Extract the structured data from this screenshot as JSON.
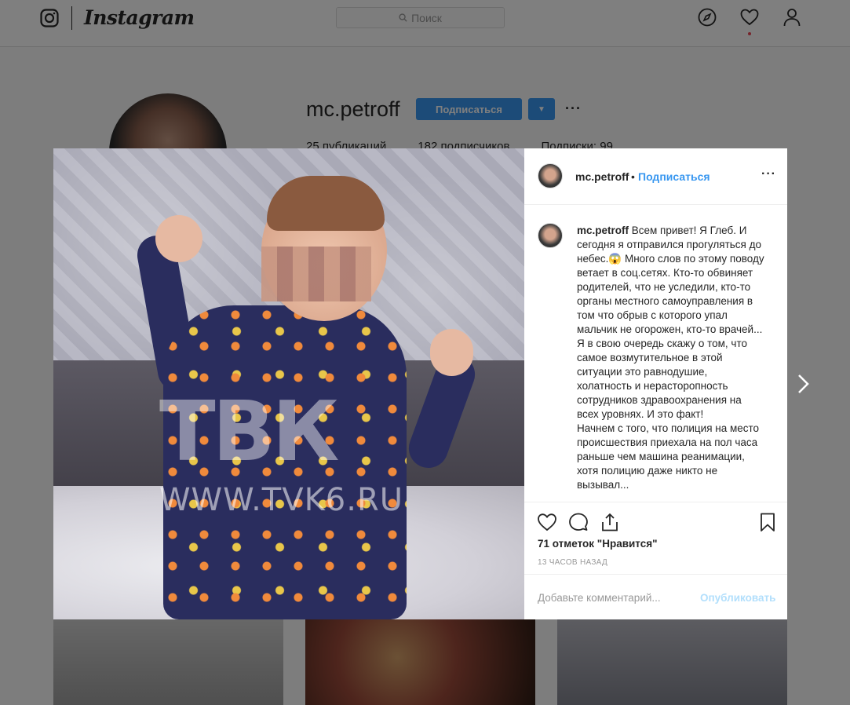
{
  "header": {
    "brand": "Instagram",
    "search_placeholder": "Поиск"
  },
  "profile": {
    "username": "mc.petroff",
    "follow_label": "Подписаться",
    "more_label": "···",
    "stats": [
      "25 публикаций",
      "182 подписчиков",
      "Подписки: 99"
    ]
  },
  "post": {
    "watermark_logo": "ТВК",
    "watermark_site": "WWW.TVK6.RU",
    "header": {
      "username": "mc.petroff",
      "separator": "•",
      "follow_label": "Подписаться",
      "more_label": "···"
    },
    "caption": {
      "username": "mc.petroff",
      "text": " Всем привет! Я Глеб. И сегодня я отправился прогуляться до небес.😱 Много слов по этому поводу ветает в соц.сетях. Кто-то обвиняет родителей, что не уследили, кто-то органы местного самоуправления в том что обрыв с которого упал мальчик не огорожен, кто-то врачей...\nЯ в свою очередь скажу о том, что самое возмутительное в этой ситуации это равнодушие, холатность и нерасторопность сотрудников здравоохранения на всех уровнях. И это факт!\nНачнем с того, что полиция на место происшествия приехала на пол часа раньше чем машина реанимации, хотя полицию даже никто не вызывал..."
    },
    "likes": "71 отметок \"Нравится\"",
    "time": "13 ЧАСОВ НАЗАД",
    "comment_placeholder": "Добавьте комментарий...",
    "publish_label": "Опубликовать"
  },
  "colors": {
    "accent": "#3897f0",
    "publish_disabled": "#b2dffc",
    "notification": "#ed4956"
  }
}
